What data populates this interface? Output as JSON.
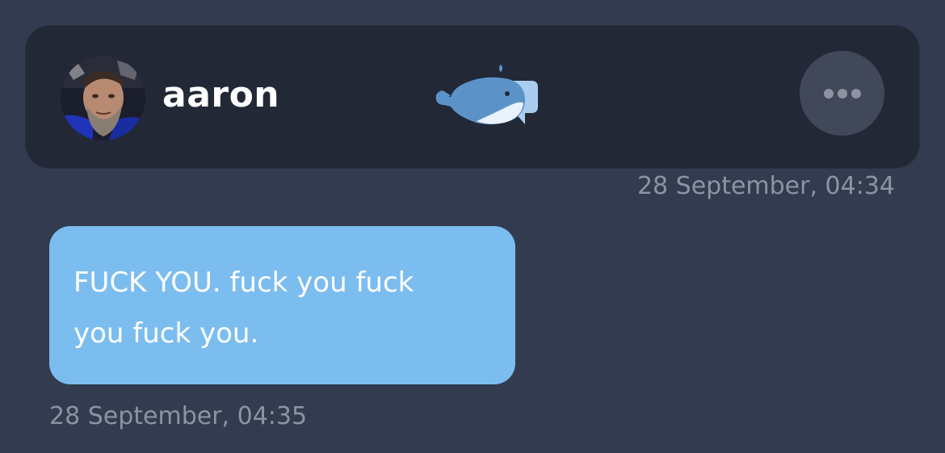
{
  "header": {
    "username": "aaron",
    "avatar": "avatar-photo",
    "logo": "whale-chat-logo-icon",
    "more_icon": "more-dots-icon",
    "timestamp": "28 September, 04:34"
  },
  "message": {
    "text": "FUCK YOU. fuck you fuck\nyou fuck you.",
    "timestamp": "28 September, 04:35",
    "bubble_color": "#7cbdf0"
  },
  "colors": {
    "background": "#323b4f",
    "card": "#222836",
    "more_button": "#41485a",
    "muted_text": "#8d93a0"
  }
}
